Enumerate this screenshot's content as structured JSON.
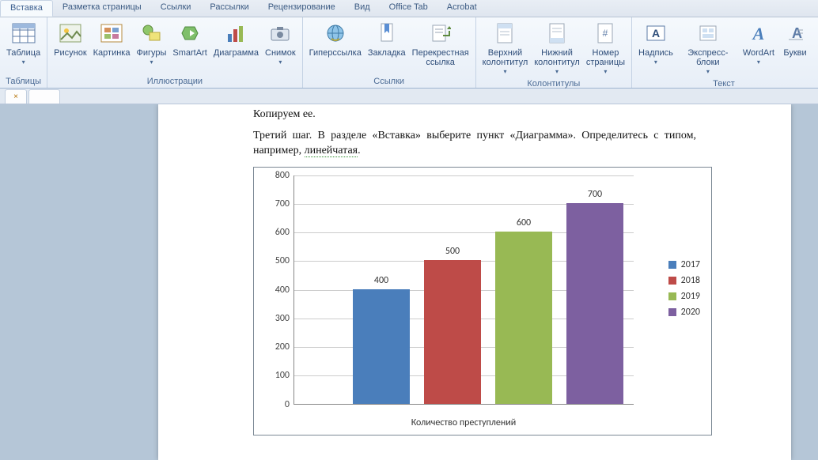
{
  "tabs": [
    "Вставка",
    "Разметка страницы",
    "Ссылки",
    "Рассылки",
    "Рецензирование",
    "Вид",
    "Office Tab",
    "Acrobat"
  ],
  "active_tab": 0,
  "ribbon_groups": {
    "tables": {
      "title": "Таблицы",
      "items": [
        "Таблица"
      ]
    },
    "illustrations": {
      "title": "Иллюстрации",
      "items": [
        "Рисунок",
        "Картинка",
        "Фигуры",
        "SmartArt",
        "Диаграмма",
        "Снимок"
      ]
    },
    "links": {
      "title": "Ссылки",
      "items": [
        "Гиперссылка",
        "Закладка",
        "Перекрестная\nссылка"
      ]
    },
    "headerfooter": {
      "title": "Колонтитулы",
      "items": [
        "Верхний\nколонтитул",
        "Нижний\nколонтитул",
        "Номер\nстраницы"
      ]
    },
    "text": {
      "title": "Текст",
      "items": [
        "Надпись",
        "Экспресс-блоки",
        "WordArt",
        "Букви"
      ]
    }
  },
  "doc_tab_close": "×",
  "document": {
    "p1": "Копируем ее.",
    "p2a": "Третий шаг. В разделе «Вставка» выберите пункт «Диаграмма». Определитесь с типом, например, ",
    "p2_underlined": "линейчатая",
    "p2b": "."
  },
  "chart_data": {
    "type": "bar",
    "categories": [
      "2017",
      "2018",
      "2019",
      "2020"
    ],
    "values": [
      400,
      500,
      600,
      700
    ],
    "xlabel": "Количество преступлений",
    "ylabel": "",
    "ylim": [
      0,
      800
    ],
    "ystep": 100,
    "legend": [
      "2017",
      "2018",
      "2019",
      "2020"
    ],
    "colors": [
      "#4a7ebb",
      "#be4b48",
      "#98b954",
      "#7d60a0"
    ]
  }
}
